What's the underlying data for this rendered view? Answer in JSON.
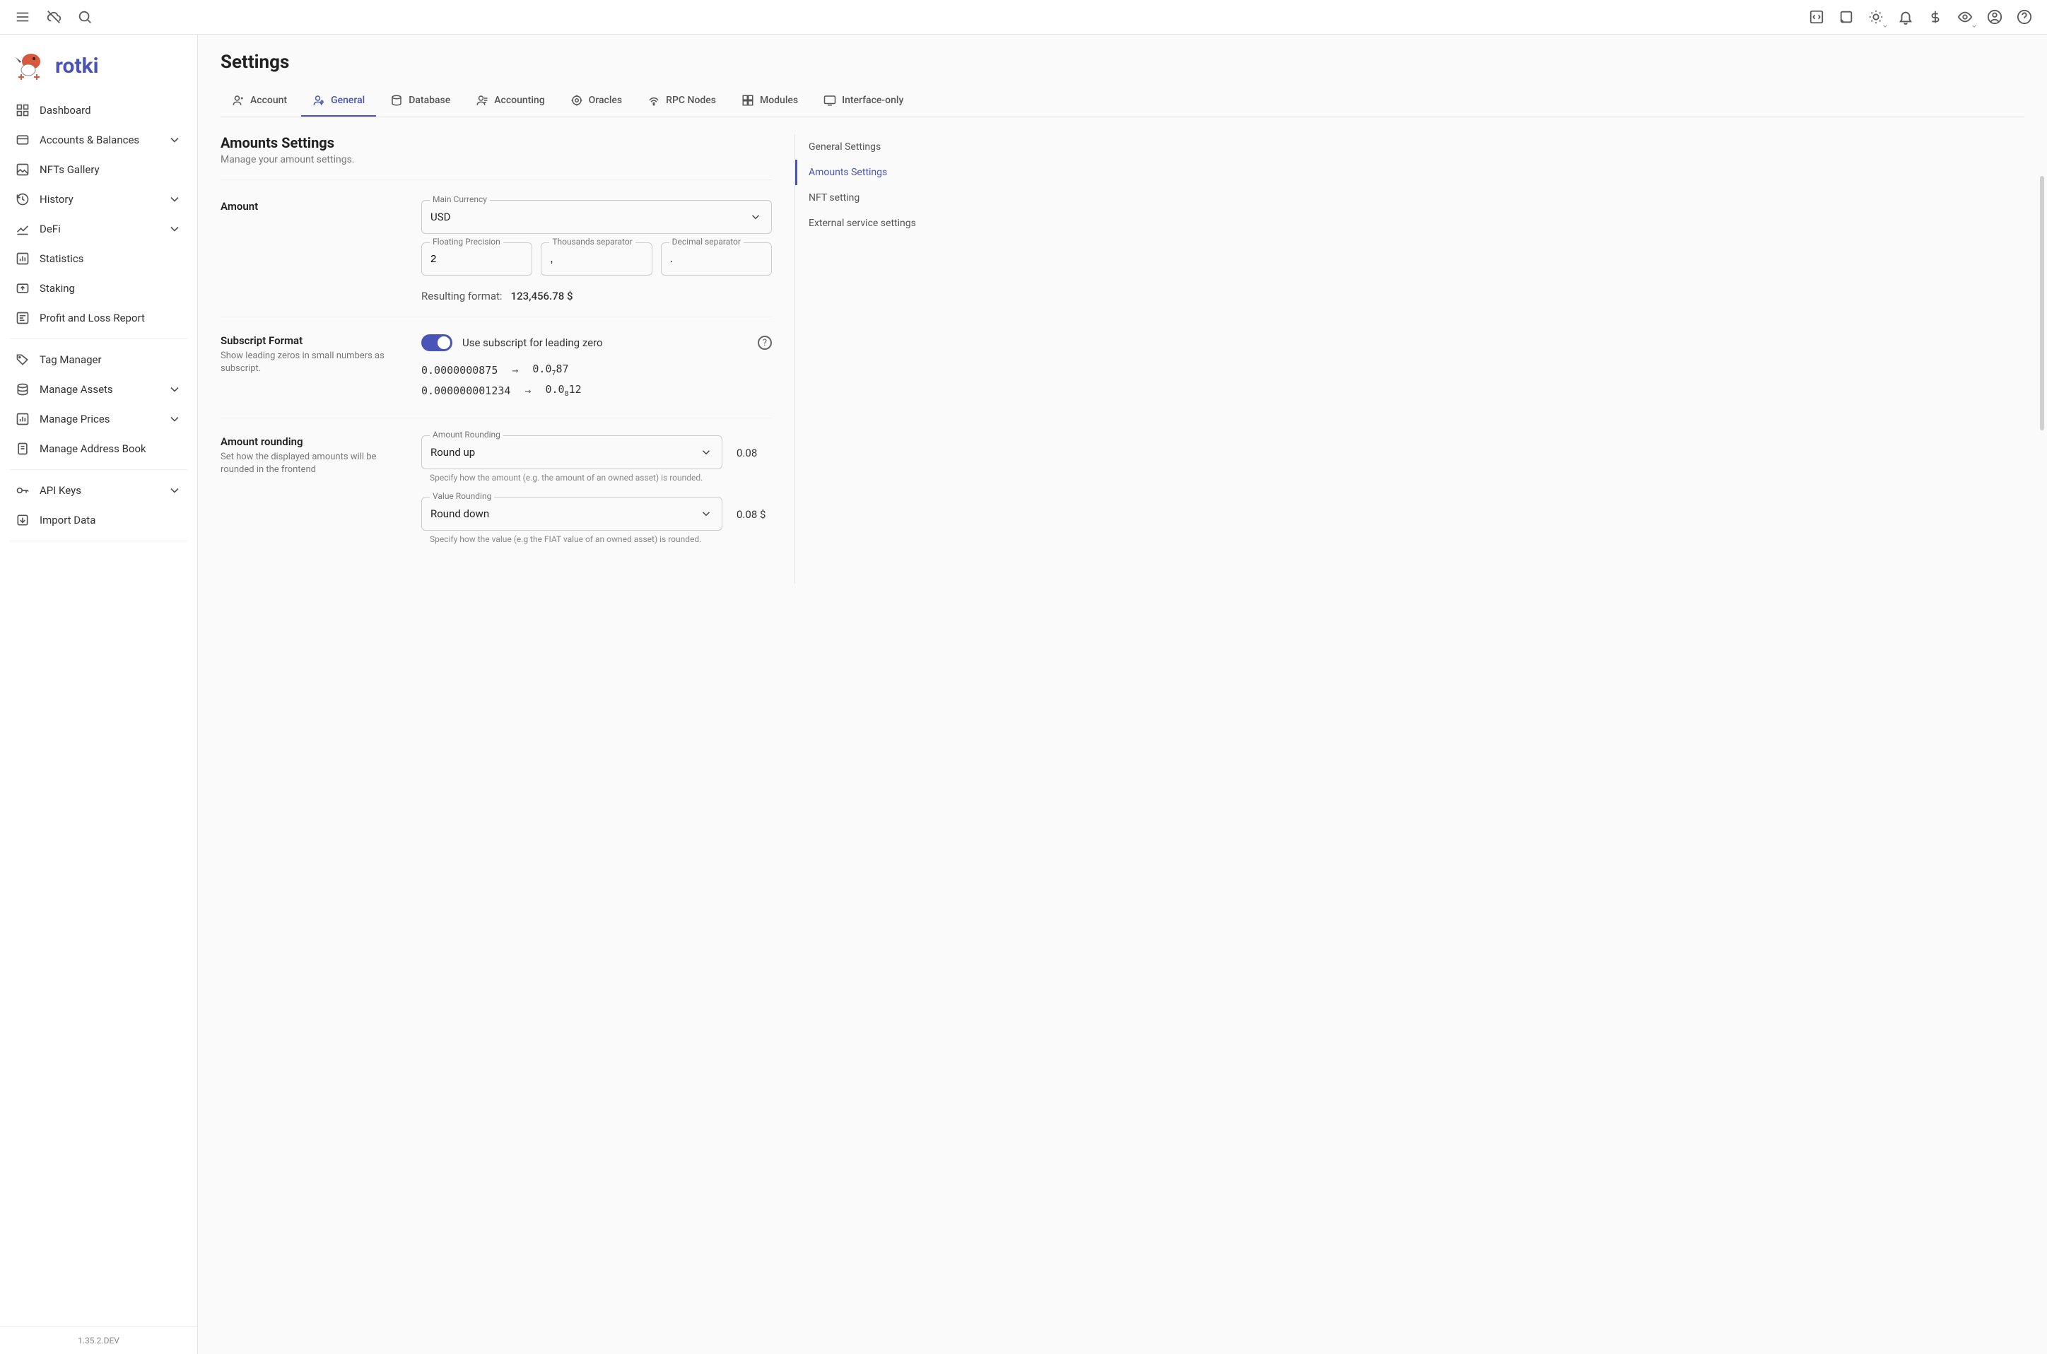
{
  "brand": {
    "name": "rotki"
  },
  "version": "1.35.2.DEV",
  "sidebar": {
    "items": [
      {
        "label": "Dashboard",
        "expandable": false
      },
      {
        "label": "Accounts & Balances",
        "expandable": true
      },
      {
        "label": "NFTs Gallery",
        "expandable": false
      },
      {
        "label": "History",
        "expandable": true
      },
      {
        "label": "DeFi",
        "expandable": true
      },
      {
        "label": "Statistics",
        "expandable": false
      },
      {
        "label": "Staking",
        "expandable": false
      },
      {
        "label": "Profit and Loss Report",
        "expandable": false
      }
    ],
    "items2": [
      {
        "label": "Tag Manager",
        "expandable": false
      },
      {
        "label": "Manage Assets",
        "expandable": true
      },
      {
        "label": "Manage Prices",
        "expandable": true
      },
      {
        "label": "Manage Address Book",
        "expandable": false
      }
    ],
    "items3": [
      {
        "label": "API Keys",
        "expandable": true
      },
      {
        "label": "Import Data",
        "expandable": false
      }
    ]
  },
  "page": {
    "title": "Settings"
  },
  "tabs": [
    {
      "label": "Account"
    },
    {
      "label": "General"
    },
    {
      "label": "Database"
    },
    {
      "label": "Accounting"
    },
    {
      "label": "Oracles"
    },
    {
      "label": "RPC Nodes"
    },
    {
      "label": "Modules"
    },
    {
      "label": "Interface-only"
    }
  ],
  "sideNav": [
    {
      "label": "General Settings"
    },
    {
      "label": "Amounts Settings"
    },
    {
      "label": "NFT setting"
    },
    {
      "label": "External service settings"
    }
  ],
  "section": {
    "title": "Amounts Settings",
    "subtitle": "Manage your amount settings."
  },
  "amount": {
    "rowTitle": "Amount",
    "mainCurrency": {
      "label": "Main Currency",
      "value": "USD"
    },
    "floatingPrecision": {
      "label": "Floating Precision",
      "value": "2"
    },
    "thousandsSeparator": {
      "label": "Thousands separator",
      "value": ","
    },
    "decimalSeparator": {
      "label": "Decimal separator",
      "value": "."
    },
    "resulting": {
      "label": "Resulting format:",
      "value": "123,456.78 $"
    }
  },
  "subscript": {
    "rowTitle": "Subscript Format",
    "rowSub": "Show leading zeros in small numbers as subscript.",
    "toggleLabel": "Use subscript for leading zero",
    "examples": [
      {
        "from": "0.0000000875",
        "toPrefix": "0.0",
        "toSub": "7",
        "toSuffix": "87"
      },
      {
        "from": "0.000000001234",
        "toPrefix": "0.0",
        "toSub": "8",
        "toSuffix": "12"
      }
    ]
  },
  "rounding": {
    "rowTitle": "Amount rounding",
    "rowSub": "Set how the displayed amounts will be rounded in the frontend",
    "amountRounding": {
      "label": "Amount Rounding",
      "value": "Round up",
      "hint": "Specify how the amount (e.g. the amount of an owned asset) is rounded.",
      "example": "0.08"
    },
    "valueRounding": {
      "label": "Value Rounding",
      "value": "Round down",
      "hint": "Specify how the value (e.g the FIAT value of an owned asset) is rounded.",
      "example": "0.08 $"
    }
  }
}
